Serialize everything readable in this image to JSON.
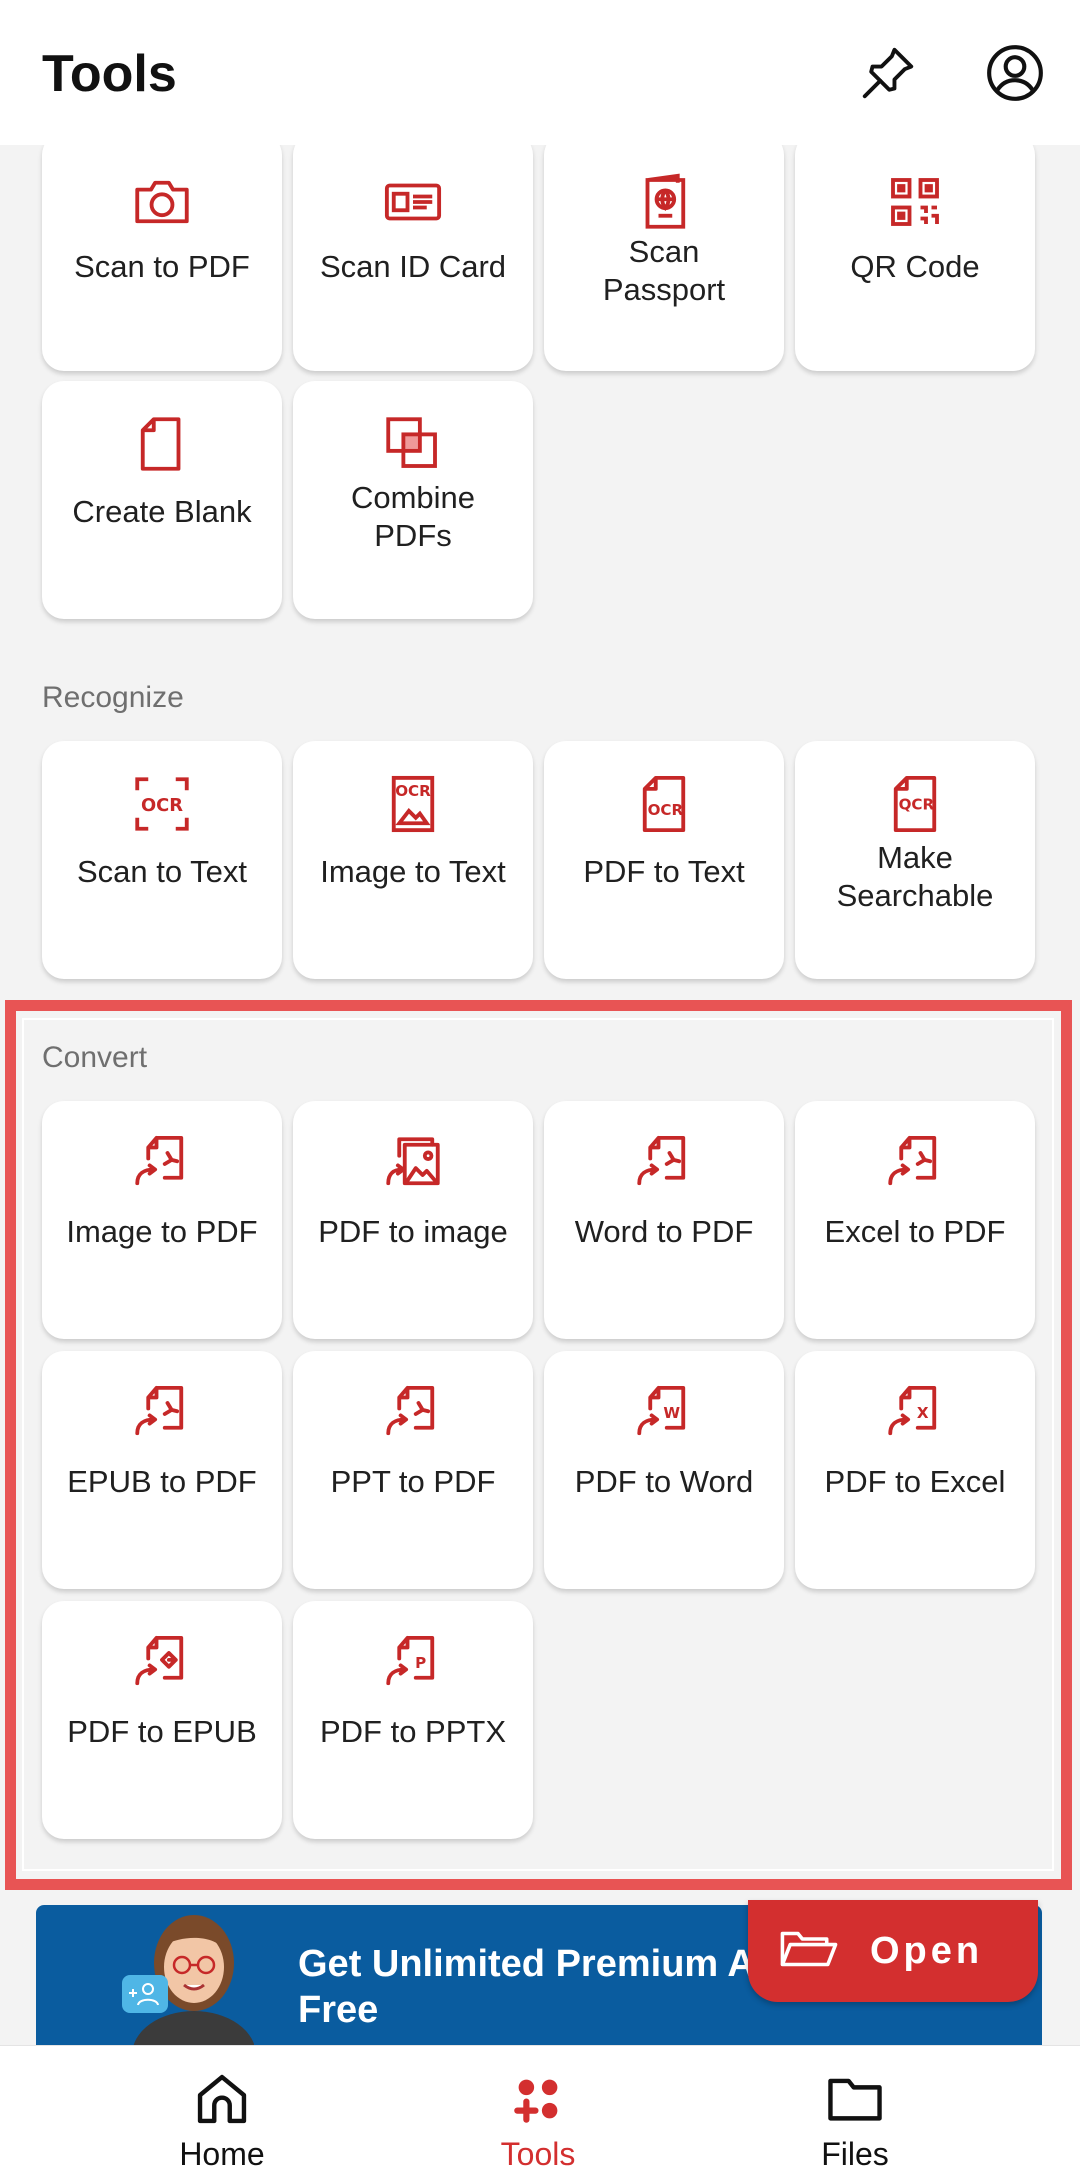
{
  "header": {
    "title": "Tools",
    "pin_icon": "pin-icon",
    "account_icon": "account-icon"
  },
  "create_section": {
    "tools": [
      {
        "label": "Scan to PDF",
        "icon": "camera-icon"
      },
      {
        "label": "Scan ID Card",
        "icon": "id-card-icon"
      },
      {
        "label": "Scan\nPassport",
        "icon": "passport-icon"
      },
      {
        "label": "QR Code",
        "icon": "qr-code-icon"
      },
      {
        "label": "Create Blank",
        "icon": "blank-page-icon"
      },
      {
        "label": "Combine\nPDFs",
        "icon": "combine-icon"
      }
    ]
  },
  "recognize_section": {
    "label": "Recognize",
    "tools": [
      {
        "label": "Scan to Text",
        "icon": "ocr-scan-icon"
      },
      {
        "label": "Image to Text",
        "icon": "ocr-image-icon"
      },
      {
        "label": "PDF to Text",
        "icon": "ocr-pdf-icon"
      },
      {
        "label": "Make\nSearchable",
        "icon": "qcr-icon"
      }
    ]
  },
  "convert_section": {
    "label": "Convert",
    "tools": [
      {
        "label": "Image to PDF",
        "icon": "image-to-pdf-icon"
      },
      {
        "label": "PDF to image",
        "icon": "pdf-to-image-icon"
      },
      {
        "label": "Word to PDF",
        "icon": "word-to-pdf-icon"
      },
      {
        "label": "Excel to PDF",
        "icon": "excel-to-pdf-icon"
      },
      {
        "label": "EPUB to PDF",
        "icon": "epub-to-pdf-icon"
      },
      {
        "label": "PPT to PDF",
        "icon": "ppt-to-pdf-icon"
      },
      {
        "label": "PDF to Word",
        "icon": "pdf-to-word-icon"
      },
      {
        "label": "PDF to Excel",
        "icon": "pdf-to-excel-icon"
      },
      {
        "label": "PDF to EPUB",
        "icon": "pdf-to-epub-icon"
      },
      {
        "label": "PDF to PPTX",
        "icon": "pdf-to-pptx-icon"
      }
    ]
  },
  "banner": {
    "text": "Get Unlimited Premium A\nFree"
  },
  "fab": {
    "label": "Open",
    "icon": "folder-open-icon"
  },
  "bottom_nav": {
    "items": [
      {
        "label": "Home",
        "icon": "home-icon",
        "active": false
      },
      {
        "label": "Tools",
        "icon": "tools-icon",
        "active": true
      },
      {
        "label": "Files",
        "icon": "folder-icon",
        "active": false
      }
    ]
  },
  "colors": {
    "accent": "#d32f2f",
    "highlight": "#e85454",
    "banner": "#0a5c9f",
    "background": "#f3f3f3"
  }
}
